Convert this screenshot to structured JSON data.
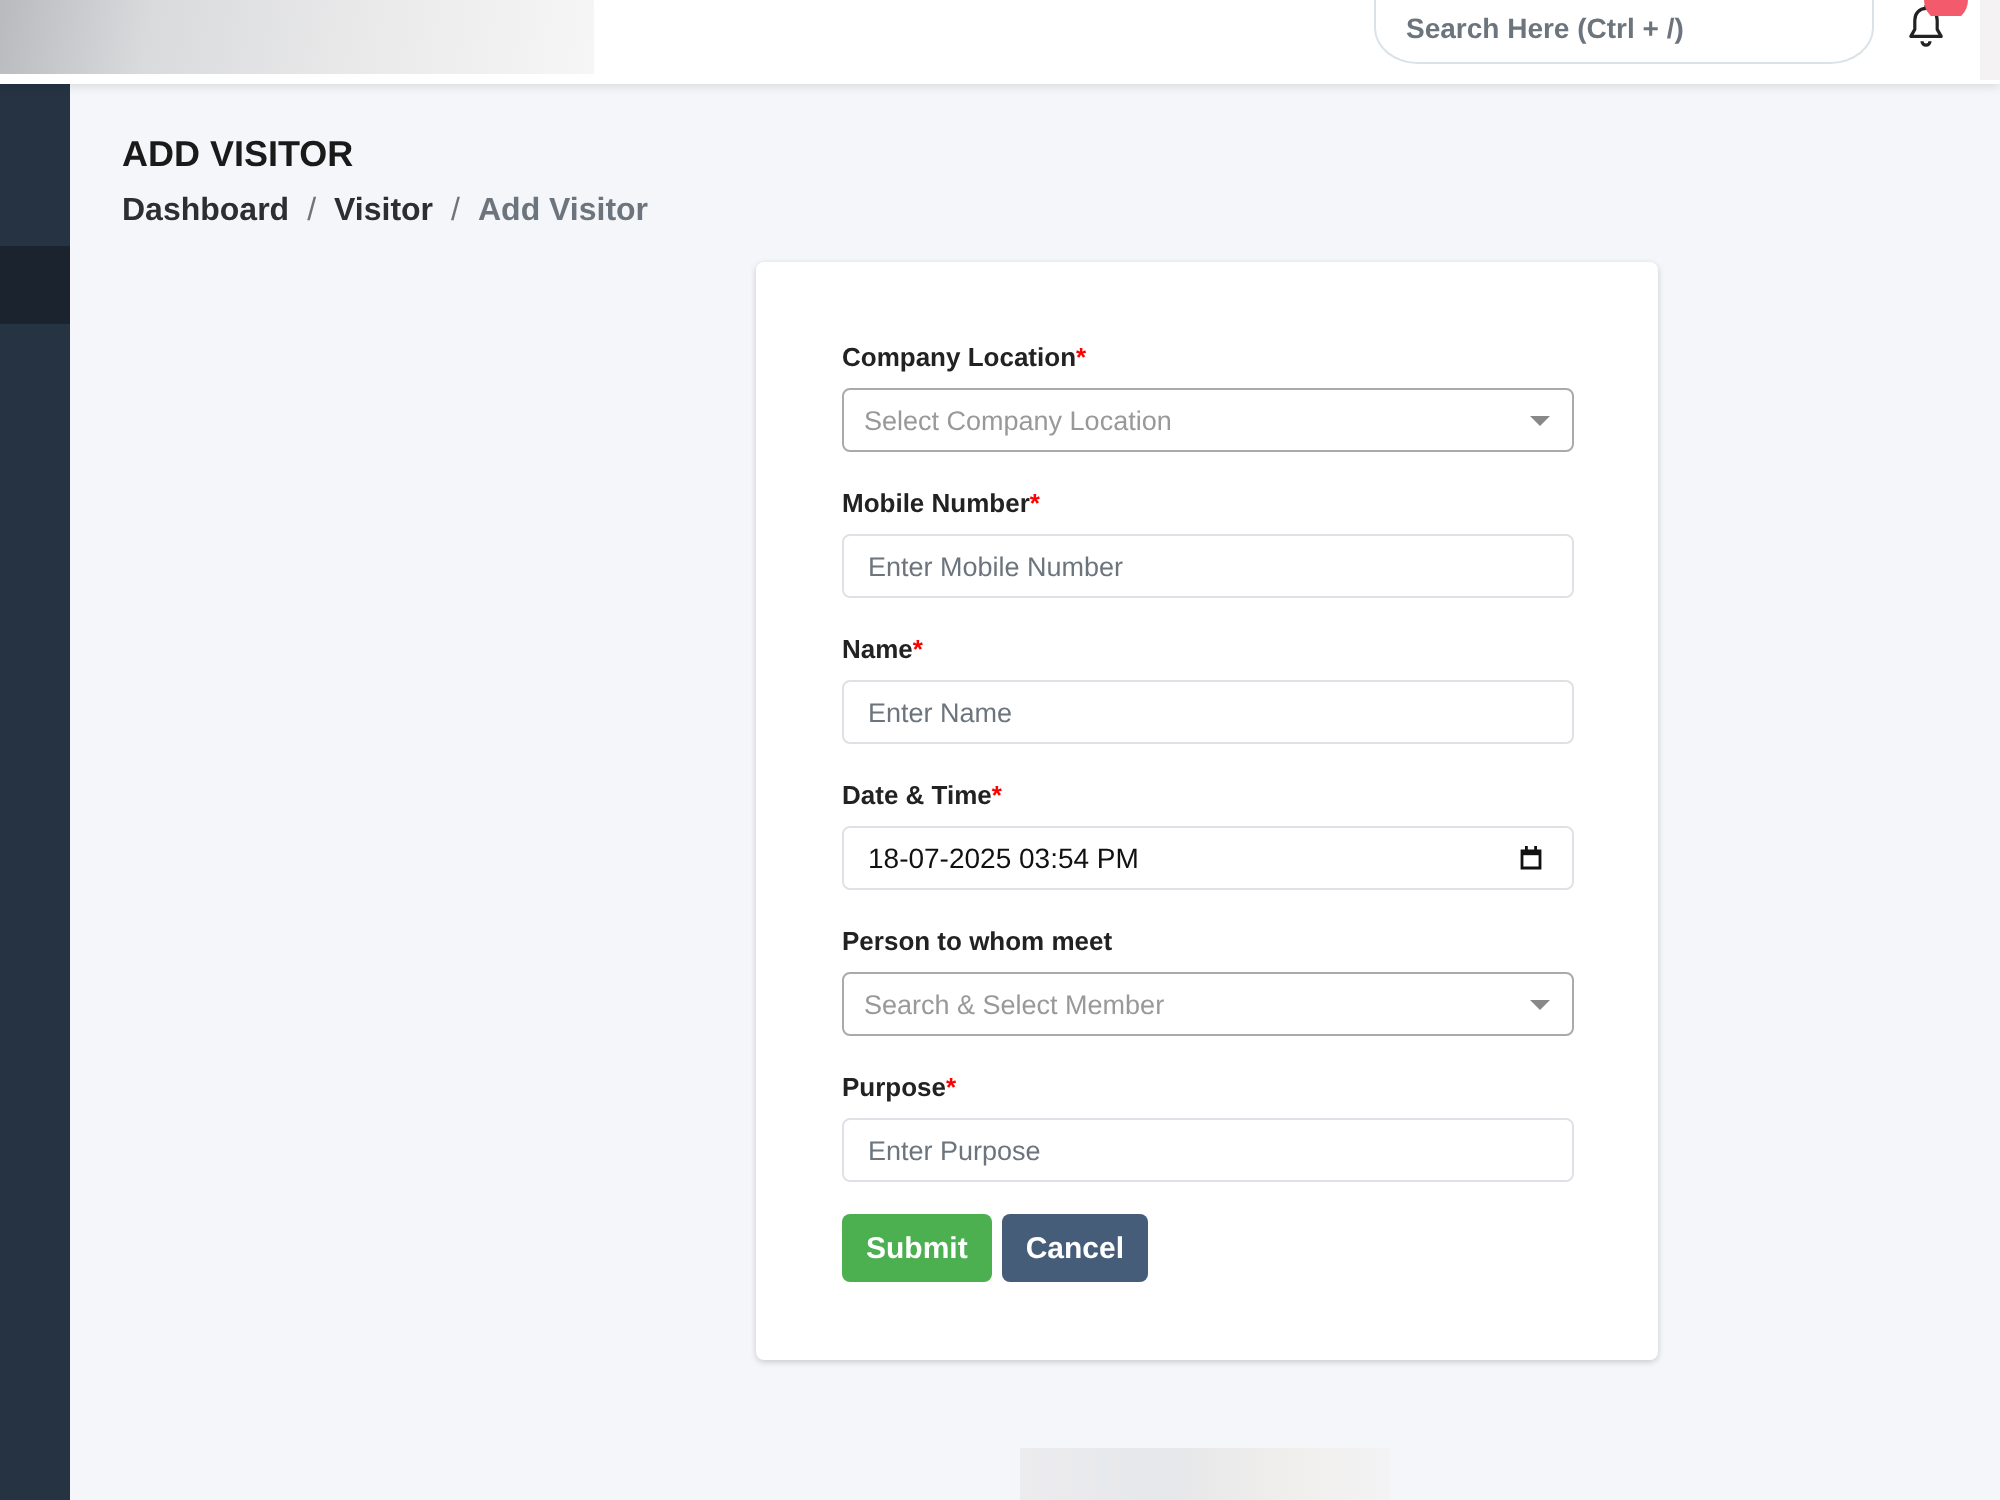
{
  "topbar": {
    "search": {
      "placeholder": "Search Here (Ctrl + /)"
    }
  },
  "sidebar": {
    "items": [
      {
        "selected": true
      }
    ]
  },
  "page": {
    "title": "ADD VISITOR",
    "breadcrumb": [
      {
        "label": "Dashboard",
        "current": false,
        "separator": "/"
      },
      {
        "label": "Visitor",
        "current": false,
        "separator": "/"
      },
      {
        "label": "Add Visitor",
        "current": true
      }
    ]
  },
  "form": {
    "fields": [
      {
        "kind": "select",
        "label": "Company Location",
        "required_mark": "*",
        "placeholder": "Select Company Location"
      },
      {
        "kind": "text",
        "label": "Mobile Number",
        "required_mark": "*",
        "placeholder": "Enter Mobile Number"
      },
      {
        "kind": "text",
        "label": "Name",
        "required_mark": "*",
        "placeholder": "Enter Name"
      },
      {
        "kind": "datetime",
        "label": "Date & Time",
        "required_mark": "*",
        "value": "18-07-2025 03:54 PM"
      },
      {
        "kind": "select",
        "label": "Person to whom meet",
        "placeholder": "Search & Select Member"
      },
      {
        "kind": "text",
        "label": "Purpose",
        "required_mark": "*",
        "placeholder": "Enter Purpose"
      }
    ],
    "buttons": [
      {
        "kind": "primary",
        "label": "Submit"
      },
      {
        "kind": "secondary",
        "label": "Cancel"
      }
    ]
  }
}
